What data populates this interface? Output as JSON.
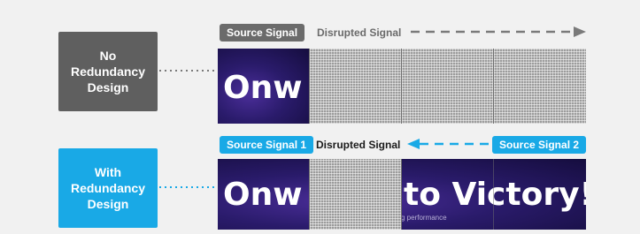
{
  "top": {
    "design_box": "No\nRedundancy\nDesign",
    "source_pill": "Source Signal",
    "disrupted_label": "Disrupted Signal",
    "screen_text": "Onw"
  },
  "bottom": {
    "design_box": "With\nRedundancy\nDesign",
    "source_pill_1": "Source Signal 1",
    "disrupted_label": "Disrupted Signal",
    "source_pill_2": "Source Signal 2",
    "screen_text_left": "Onw",
    "screen_text_right": "to Victory!",
    "screen_subtext": "g performance"
  },
  "colors": {
    "gray_box": "#5f5f5f",
    "blue_box": "#19a9e6",
    "dashed_gray": "#7a7a7a",
    "dashed_blue": "#19a9e6"
  }
}
